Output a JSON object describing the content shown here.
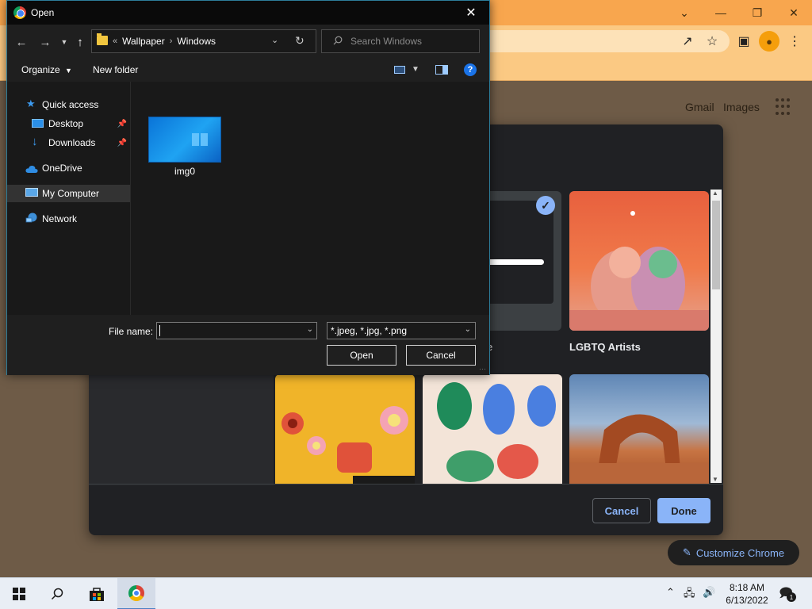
{
  "colors": {
    "chrome_titlebar": "#f8a64e",
    "chrome_toolbar": "#fbc983",
    "dialog_bg": "#1f1f1f",
    "accent_blue": "#8ab4f8",
    "taskbar": "#e9eef5"
  },
  "chrome": {
    "gmail_link": "Gmail",
    "images_link": "Images",
    "customize_chrome_label": "Customize Chrome"
  },
  "customize_dialog": {
    "selected_tile_text": "ogle",
    "tile_labels": [
      "e",
      "LGBTQ Artists"
    ],
    "cancel_label": "Cancel",
    "done_label": "Done"
  },
  "open_dialog": {
    "title": "Open",
    "breadcrumb": {
      "overflow": "«",
      "segments": [
        "Wallpaper",
        "Windows"
      ]
    },
    "search_placeholder": "Search Windows",
    "toolbar": {
      "organize_label": "Organize",
      "new_folder_label": "New folder"
    },
    "nav_items": [
      {
        "label": "Quick access",
        "icon": "star-icon"
      },
      {
        "label": "Desktop",
        "icon": "desktop-icon",
        "pinned": true
      },
      {
        "label": "Downloads",
        "icon": "download-icon",
        "pinned": true
      },
      {
        "label": "OneDrive",
        "icon": "cloud-icon"
      },
      {
        "label": "My Computer",
        "icon": "computer-icon",
        "selected": true
      },
      {
        "label": "Network",
        "icon": "network-icon"
      }
    ],
    "files": [
      {
        "name": "img0",
        "icon": "image-thumbnail"
      }
    ],
    "file_name_label": "File name:",
    "file_name_value": "",
    "file_type_value": "*.jpeg, *.jpg, *.png",
    "open_label": "Open",
    "cancel_label": "Cancel"
  },
  "taskbar": {
    "time": "8:18 AM",
    "date": "6/13/2022",
    "notification_count": "1"
  }
}
